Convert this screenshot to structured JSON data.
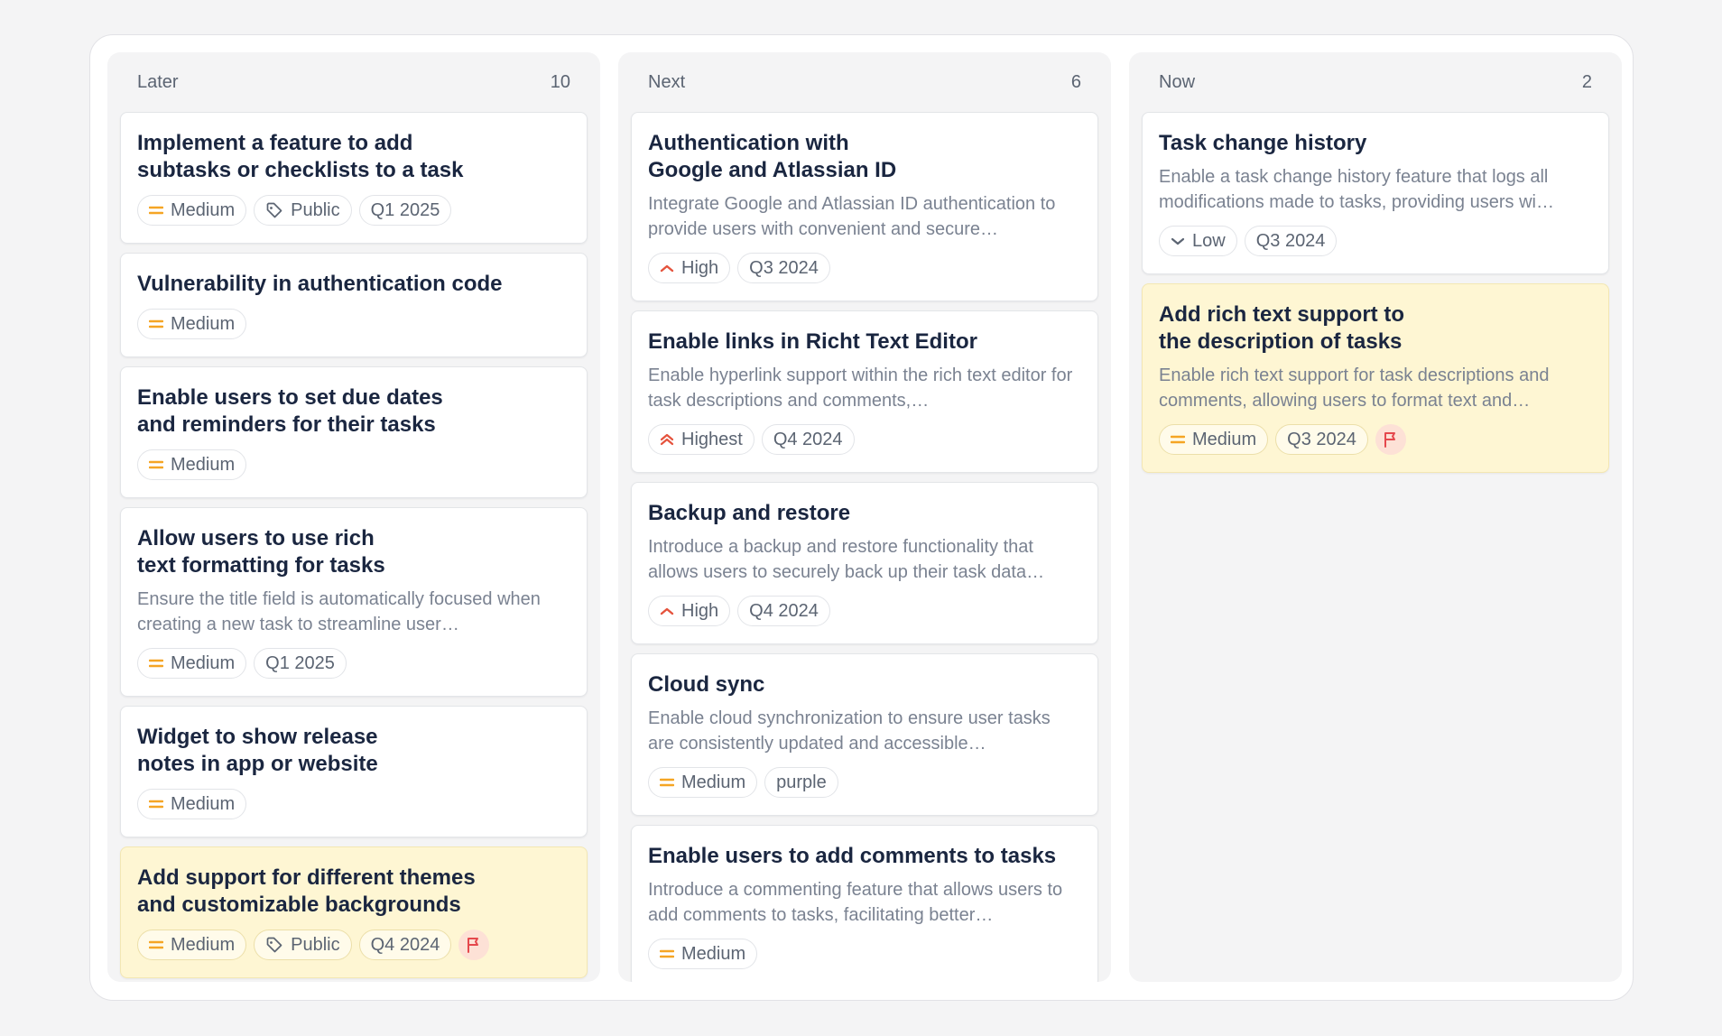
{
  "columns": [
    {
      "name": "Later",
      "count": "10",
      "cards": [
        {
          "title": "Implement a feature to add\nsubtasks or checklists to a task",
          "priority": "Medium",
          "tag": "Public",
          "quarter": "Q1 2025"
        },
        {
          "title": "Vulnerability in authentication code",
          "priority": "Medium"
        },
        {
          "title": "Enable users to set due dates\nand reminders for their tasks",
          "priority": "Medium"
        },
        {
          "title": "Allow users to use rich\ntext formatting for tasks",
          "description": "Ensure the title field is automatically focused when creating a new task to streamline user…",
          "priority": "Medium",
          "quarter": "Q1 2025"
        },
        {
          "title": "Widget to show release\nnotes in app or website",
          "priority": "Medium"
        },
        {
          "title": "Add support for different themes\nand customizable backgrounds",
          "priority": "Medium",
          "tag": "Public",
          "quarter": "Q4 2024"
        }
      ]
    },
    {
      "name": "Next",
      "count": "6",
      "cards": [
        {
          "title": "Authentication with\nGoogle and Atlassian ID",
          "description": "Integrate Google and Atlassian ID authentication to provide users with convenient and secure…",
          "priority": "High",
          "quarter": "Q3 2024"
        },
        {
          "title": "Enable links in Richt Text Editor",
          "description": "Enable hyperlink support within the rich text editor for task descriptions and comments,…",
          "priority": "Highest",
          "quarter": "Q4 2024"
        },
        {
          "title": "Backup and restore",
          "description": "Introduce a backup and restore functionality that allows users to securely back up their task data…",
          "priority": "High",
          "quarter": "Q4 2024"
        },
        {
          "title": "Cloud sync",
          "description": "Enable cloud synchronization to ensure user tasks are consistently updated and accessible…",
          "priority": "Medium",
          "label": "purple"
        },
        {
          "title": "Enable users to add comments to tasks",
          "description": "Introduce a commenting feature that allows users to add comments to tasks, facilitating better…",
          "priority": "Medium"
        }
      ]
    },
    {
      "name": "Now",
      "count": "2",
      "cards": [
        {
          "title": "Task change history",
          "description": "Enable a task change history feature that logs all modifications made to tasks, providing users wi…",
          "priority": "Low",
          "quarter": "Q3 2024"
        },
        {
          "title": "Add rich text support to\nthe description of tasks",
          "description": "Enable rich text support for task descriptions and comments, allowing users to format text and…",
          "priority": "Medium",
          "quarter": "Q3 2024"
        }
      ]
    }
  ],
  "colors": {
    "medium": "#f5a524",
    "high": "#e5533d",
    "low": "#5b6472",
    "flag": "#e5484d",
    "flagged_card": "#fef6d3"
  },
  "icons": {
    "medium": "equals-icon",
    "high": "chevron-up-icon",
    "highest": "double-chevron-up-icon",
    "low": "chevron-down-icon",
    "tag": "tag-icon",
    "flag": "flag-icon"
  }
}
